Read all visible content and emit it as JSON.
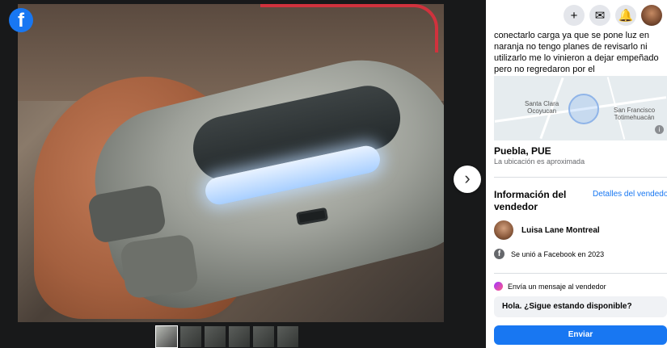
{
  "viewer": {
    "logo_glyph": "f",
    "next_glyph": "›",
    "thumbnail_count": 6
  },
  "topbar": {
    "add_glyph": "+",
    "messenger_glyph": "✉",
    "notifications_glyph": "🔔"
  },
  "listing": {
    "description": "conectarlo carga ya que se pone luz en naranja no tengo planes de revisarlo ni utilizarlo me lo vinieron a dejar empeñado pero no regredaron por el",
    "map": {
      "label_left": "Santa Clara\nOcoyucan",
      "label_right": "San Francisco\nTotimehuacán",
      "info_glyph": "i"
    },
    "location": "Puebla, PUE",
    "location_note": "La ubicación es aproximada"
  },
  "seller": {
    "heading": "Información del vendedor",
    "details_link": "Detalles del vendedor",
    "name": "Luisa Lane Montreal",
    "joined": "Se unió a Facebook en 2023"
  },
  "message": {
    "prompt": "Envía un mensaje al vendedor",
    "input_value": "Hola. ¿Sigue estando disponible?",
    "send_label": "Enviar"
  },
  "colors": {
    "brand": "#1877f2",
    "panel_bg": "#ffffff",
    "viewer_bg": "#18191a"
  },
  "icons": {
    "logo": "facebook-logo-icon",
    "next": "chevron-right-icon",
    "add": "plus-icon",
    "messenger": "messenger-icon",
    "notifications": "bell-icon"
  }
}
